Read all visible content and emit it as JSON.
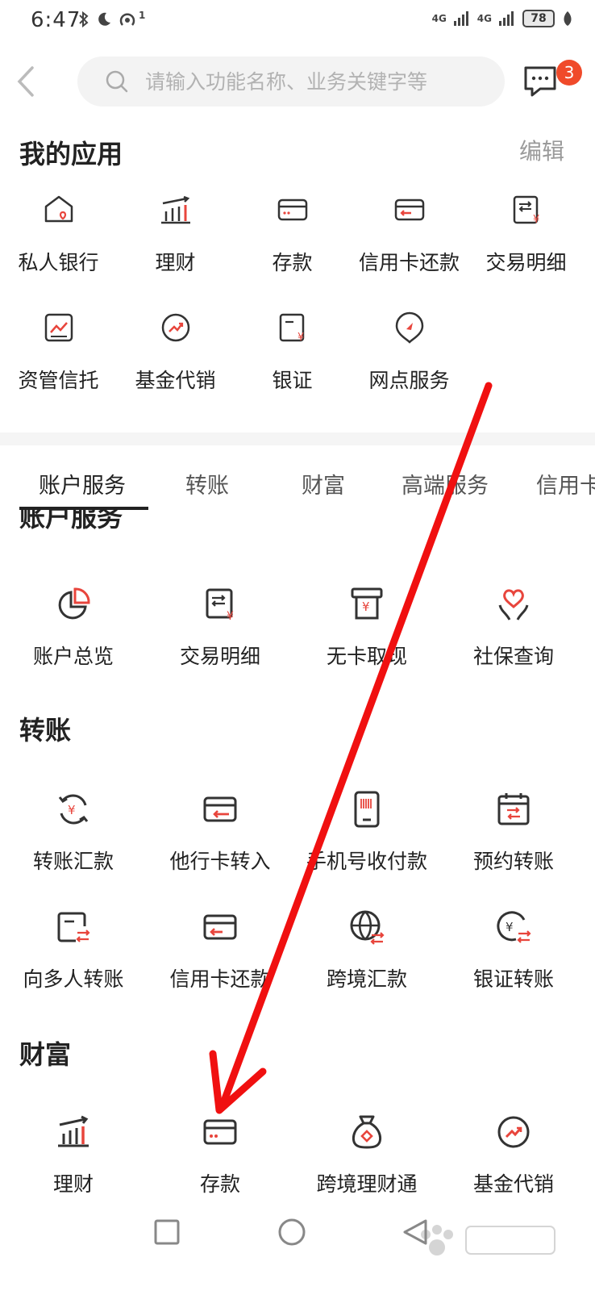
{
  "status": {
    "time": "6:47",
    "battery": "78",
    "sig1": "4G",
    "sig2": "4G",
    "hotspot_count": "1"
  },
  "search": {
    "placeholder": "请输入功能名称、业务关键字等"
  },
  "messages": {
    "badge": "3"
  },
  "my_apps": {
    "title": "我的应用",
    "edit": "编辑",
    "items": [
      {
        "label": "私人银行",
        "icon": "private-bank-icon"
      },
      {
        "label": "理财",
        "icon": "wealth-chart-icon"
      },
      {
        "label": "存款",
        "icon": "deposit-card-icon"
      },
      {
        "label": "信用卡还款",
        "icon": "credit-card-repay-icon"
      },
      {
        "label": "交易明细",
        "icon": "transaction-detail-icon"
      },
      {
        "label": "资管信托",
        "icon": "asset-trust-icon"
      },
      {
        "label": "基金代销",
        "icon": "fund-icon"
      },
      {
        "label": "银证",
        "icon": "bank-securities-icon"
      },
      {
        "label": "网点服务",
        "icon": "branch-location-icon"
      }
    ]
  },
  "tabs": [
    "账户服务",
    "转账",
    "财富",
    "高端服务",
    "信用卡"
  ],
  "sticky_title": "账户服务",
  "sections": {
    "account": {
      "items": [
        {
          "label": "账户总览",
          "icon": "pie-chart-icon"
        },
        {
          "label": "交易明细",
          "icon": "transaction-detail-icon"
        },
        {
          "label": "无卡取现",
          "icon": "atm-cash-icon"
        },
        {
          "label": "社保查询",
          "icon": "social-security-heart-icon"
        }
      ]
    },
    "transfer": {
      "title": "转账",
      "items": [
        {
          "label": "转账汇款",
          "icon": "transfer-remit-icon"
        },
        {
          "label": "他行卡转入",
          "icon": "other-bank-card-icon"
        },
        {
          "label": "手机号收付款",
          "icon": "phone-pay-icon"
        },
        {
          "label": "预约转账",
          "icon": "scheduled-transfer-icon"
        },
        {
          "label": "向多人转账",
          "icon": "multi-transfer-icon"
        },
        {
          "label": "信用卡还款",
          "icon": "credit-card-repay-icon"
        },
        {
          "label": "跨境汇款",
          "icon": "cross-border-globe-icon"
        },
        {
          "label": "银证转账",
          "icon": "securities-transfer-icon"
        }
      ]
    },
    "wealth": {
      "title": "财富",
      "items": [
        {
          "label": "理财",
          "icon": "wealth-chart-icon"
        },
        {
          "label": "存款",
          "icon": "deposit-card-icon"
        },
        {
          "label": "跨境理财通",
          "icon": "money-bag-icon"
        },
        {
          "label": "基金代销",
          "icon": "fund-icon"
        }
      ]
    }
  },
  "colors": {
    "accent": "#e8453c",
    "text": "#222222",
    "icon_stroke": "#333333",
    "arrow": "#f01010"
  }
}
